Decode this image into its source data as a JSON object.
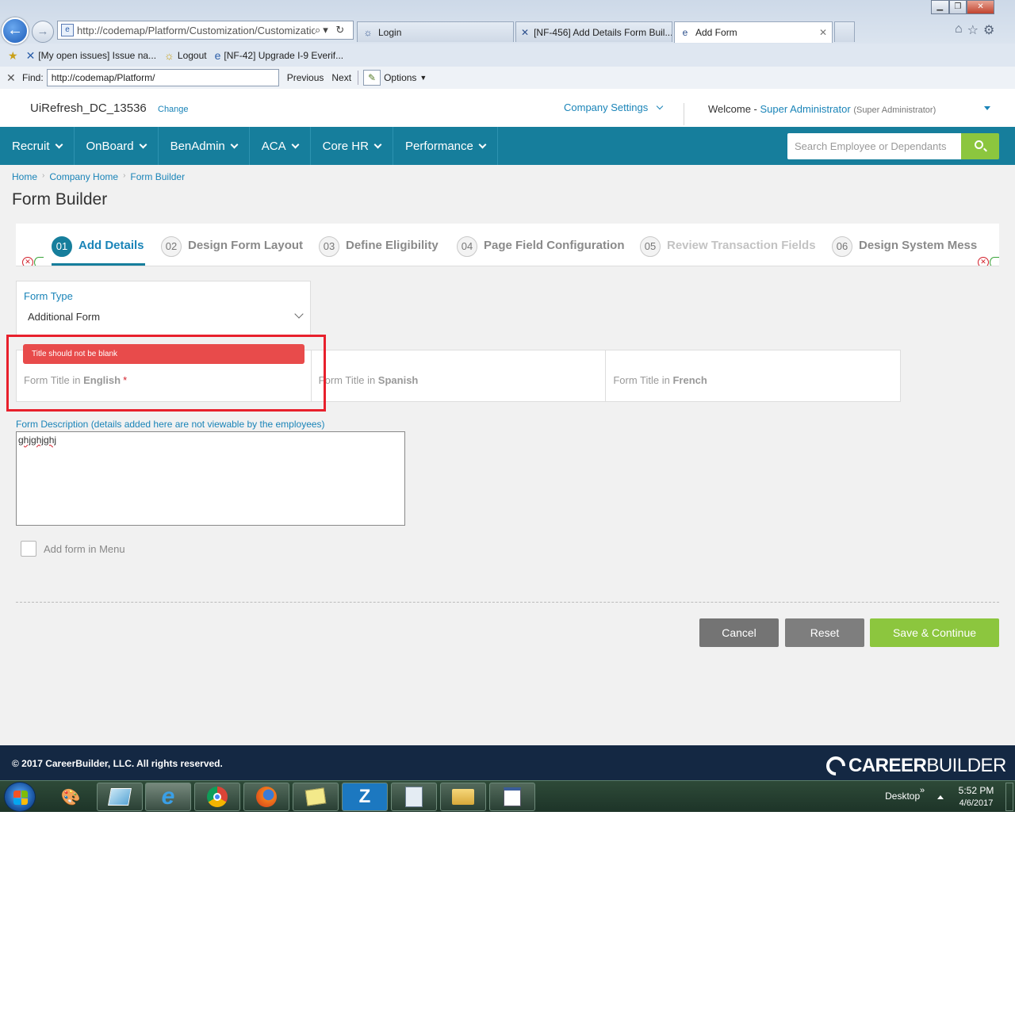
{
  "browser": {
    "address_url": "http://codemap/Platform/Customization/Customizatio",
    "address_tools": "⌕▾ ↻",
    "tabs": [
      {
        "label": "Login",
        "active": false
      },
      {
        "label": "[NF-456] Add Details Form Buil...",
        "active": false
      },
      {
        "label": "Add Form",
        "active": true
      }
    ],
    "favorites": [
      {
        "label": "[My open issues] Issue na..."
      },
      {
        "label": "Logout"
      },
      {
        "label": "[NF-42] Upgrade I-9 Everif..."
      }
    ],
    "find": {
      "label": "Find:",
      "value": "http://codemap/Platform/",
      "previous": "Previous",
      "next": "Next",
      "options": "Options"
    }
  },
  "header": {
    "company": "UiRefresh_DC_13536",
    "change": "Change",
    "company_settings": "Company Settings",
    "welcome": "Welcome -",
    "user_name": "Super Administrator",
    "user_role": "(Super Administrator)"
  },
  "nav": {
    "items": [
      {
        "label": "Recruit"
      },
      {
        "label": "OnBoard"
      },
      {
        "label": "BenAdmin"
      },
      {
        "label": "ACA"
      },
      {
        "label": "Core HR"
      },
      {
        "label": "Performance"
      }
    ],
    "search_placeholder": "Search Employee or Dependants"
  },
  "breadcrumb": [
    "Home",
    "Company Home",
    "Form Builder"
  ],
  "page_title": "Form Builder",
  "steps": [
    {
      "num": "01",
      "label": "Add Details",
      "state": "active"
    },
    {
      "num": "02",
      "label": "Design Form Layout",
      "state": "normal"
    },
    {
      "num": "03",
      "label": "Define Eligibility",
      "state": "normal"
    },
    {
      "num": "04",
      "label": "Page Field Configuration",
      "state": "normal"
    },
    {
      "num": "05",
      "label": "Review Transaction Fields",
      "state": "dim"
    },
    {
      "num": "06",
      "label": "Design System Mess",
      "state": "normal"
    }
  ],
  "form": {
    "form_type_label": "Form Type",
    "form_type_value": "Additional Form",
    "error_message": "Title should not be blank",
    "title_fields": [
      {
        "prefix": "Form Title in ",
        "lang": "English",
        "required": true
      },
      {
        "prefix": "Form Title in ",
        "lang": "Spanish",
        "required": false
      },
      {
        "prefix": "Form Title in ",
        "lang": "French",
        "required": false
      }
    ],
    "required_mark": "*",
    "description_label": "Form Description (details added here are not viewable by the employees)",
    "description_value": "ghjghjghj",
    "menu_checkbox_label": "Add form in Menu",
    "menu_checkbox_checked": false
  },
  "buttons": {
    "cancel": "Cancel",
    "reset": "Reset",
    "save": "Save & Continue"
  },
  "footer": {
    "copyright": "© 2017 CareerBuilder, LLC. All rights reserved.",
    "logo_bold": "CAREER",
    "logo_thin": "BUILDER"
  },
  "taskbar": {
    "apps": [
      {
        "icon": "paint-icon"
      },
      {
        "icon": "notepad-icon"
      },
      {
        "icon": "ie-icon",
        "active": true
      },
      {
        "icon": "chrome-icon"
      },
      {
        "icon": "firefox-icon"
      },
      {
        "icon": "sticky-notes-icon"
      },
      {
        "icon": "z-app-icon"
      },
      {
        "icon": "clipboard-icon"
      },
      {
        "icon": "folder-icon"
      },
      {
        "icon": "window-icon"
      }
    ],
    "desktop": "Desktop",
    "time": "5:52 PM",
    "date": "4/6/2017"
  },
  "colors": {
    "nav_teal": "#167e9c",
    "accent_blue": "#1a84b8",
    "save_green": "#8cc63e",
    "error_red": "#e84b4b",
    "footer_navy": "#142843"
  }
}
